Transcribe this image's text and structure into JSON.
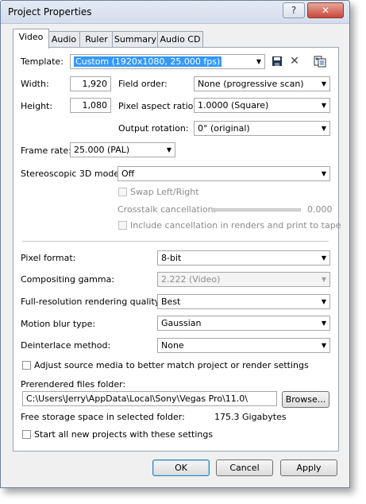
{
  "window": {
    "title": "Project Properties",
    "help_glyph": "?",
    "close_glyph": "✕"
  },
  "tabs": [
    "Video",
    "Audio",
    "Ruler",
    "Summary",
    "Audio CD"
  ],
  "video": {
    "template_label": "Template:",
    "template_value": "Custom (1920x1080, 25.000 fps)",
    "width_label": "Width:",
    "width_value": "1,920",
    "height_label": "Height:",
    "height_value": "1,080",
    "field_order_label": "Field order:",
    "field_order_value": "None (progressive scan)",
    "pixel_aspect_label": "Pixel aspect ratio:",
    "pixel_aspect_value": "1.0000 (Square)",
    "output_rotation_label": "Output rotation:",
    "output_rotation_value": "0° (original)",
    "frame_rate_label": "Frame rate:",
    "frame_rate_value": "25.000 (PAL)",
    "stereo_label": "Stereoscopic 3D mode:",
    "stereo_value": "Off",
    "swap_label": "Swap Left/Right",
    "crosstalk_label": "Crosstalk cancellation:",
    "crosstalk_value": "0.000",
    "include_cancel_label": "Include cancellation in renders and print to tape",
    "pixel_format_label": "Pixel format:",
    "pixel_format_value": "8-bit",
    "gamma_label": "Compositing gamma:",
    "gamma_value": "2.222 (Video)",
    "render_quality_label": "Full-resolution rendering quality:",
    "render_quality_value": "Best",
    "motion_blur_label": "Motion blur type:",
    "motion_blur_value": "Gaussian",
    "deinterlace_label": "Deinterlace method:",
    "deinterlace_value": "None",
    "adjust_source_label": "Adjust source media to better match project or render settings",
    "prerendered_label": "Prerendered files folder:",
    "prerendered_path": "C:\\Users\\Jerry\\AppData\\Local\\Sony\\Vegas Pro\\11.0\\",
    "browse_label": "Browse...",
    "free_space_label": "Free storage space in selected folder:",
    "free_space_value": "175.3 Gigabytes",
    "start_new_label": "Start all new projects with these settings"
  },
  "icons": {
    "save": "save-icon",
    "delete": "delete-icon",
    "match_media": "match-media-icon"
  },
  "buttons": {
    "ok": "OK",
    "cancel": "Cancel",
    "apply": "Apply"
  }
}
